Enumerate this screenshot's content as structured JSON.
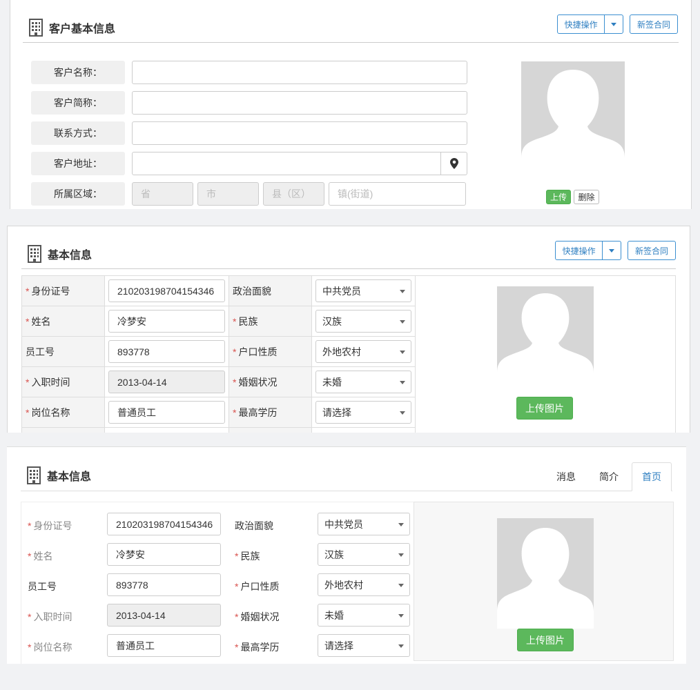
{
  "panel1": {
    "title": "客户基本信息",
    "quick_action": "快捷操作",
    "new_contract": "新签合同",
    "labels": {
      "name": "客户名称：",
      "short": "客户简称：",
      "contact": "联系方式：",
      "address": "客户地址：",
      "region": "所属区域："
    },
    "placeholders": {
      "province": "省",
      "city": "市",
      "county": "县（区）",
      "town": "镇(街道)"
    },
    "upload": "上传",
    "delete": "删除",
    "icons": {
      "title": "building-icon",
      "address": "map-marker-icon",
      "avatar": "user-silhouette-icon"
    }
  },
  "panel2": {
    "title": "基本信息",
    "quick_action": "快捷操作",
    "new_contract": "新签合同",
    "upload": "上传图片",
    "rows": [
      {
        "label": "身份证号",
        "req": true,
        "value": "210203198704154346",
        "rlabel": "政治面貌",
        "rreq": false,
        "select": "中共党员"
      },
      {
        "label": "姓名",
        "req": true,
        "value": "冷梦安",
        "rlabel": "民族",
        "rreq": true,
        "select": "汉族"
      },
      {
        "label": "员工号",
        "req": false,
        "value": "893778",
        "rlabel": "户口性质",
        "rreq": true,
        "select": "外地农村"
      },
      {
        "label": "入职时间",
        "req": true,
        "value": "2013-04-14",
        "rlabel": "婚姻状况",
        "rreq": true,
        "select": "未婚"
      },
      {
        "label": "岗位名称",
        "req": true,
        "value": "普通员工",
        "rlabel": "最高学历",
        "rreq": true,
        "select": "请选择"
      }
    ]
  },
  "panel3": {
    "title": "基本信息",
    "tabs": [
      "消息",
      "简介",
      "首页"
    ],
    "active_tab": "首页",
    "upload": "上传图片",
    "rows": [
      {
        "label": "身份证号",
        "req": true,
        "value": "210203198704154346",
        "rlabel": "政治面貌",
        "rreq": false,
        "select": "中共党员"
      },
      {
        "label": "姓名",
        "req": true,
        "value": "冷梦安",
        "rlabel": "民族",
        "rreq": true,
        "select": "汉族"
      },
      {
        "label": "员工号",
        "req": false,
        "value": "893778",
        "rlabel": "户口性质",
        "rreq": true,
        "select": "外地农村"
      },
      {
        "label": "入职时间",
        "req": true,
        "value": "2013-04-14",
        "rlabel": "婚姻状况",
        "rreq": true,
        "select": "未婚"
      },
      {
        "label": "岗位名称",
        "req": true,
        "value": "普通员工",
        "rlabel": "最高学历",
        "rreq": true,
        "select": "请选择"
      }
    ]
  },
  "colors": {
    "primary": "#2f7fc1",
    "success": "#5cb85c",
    "danger": "#d9534f"
  }
}
